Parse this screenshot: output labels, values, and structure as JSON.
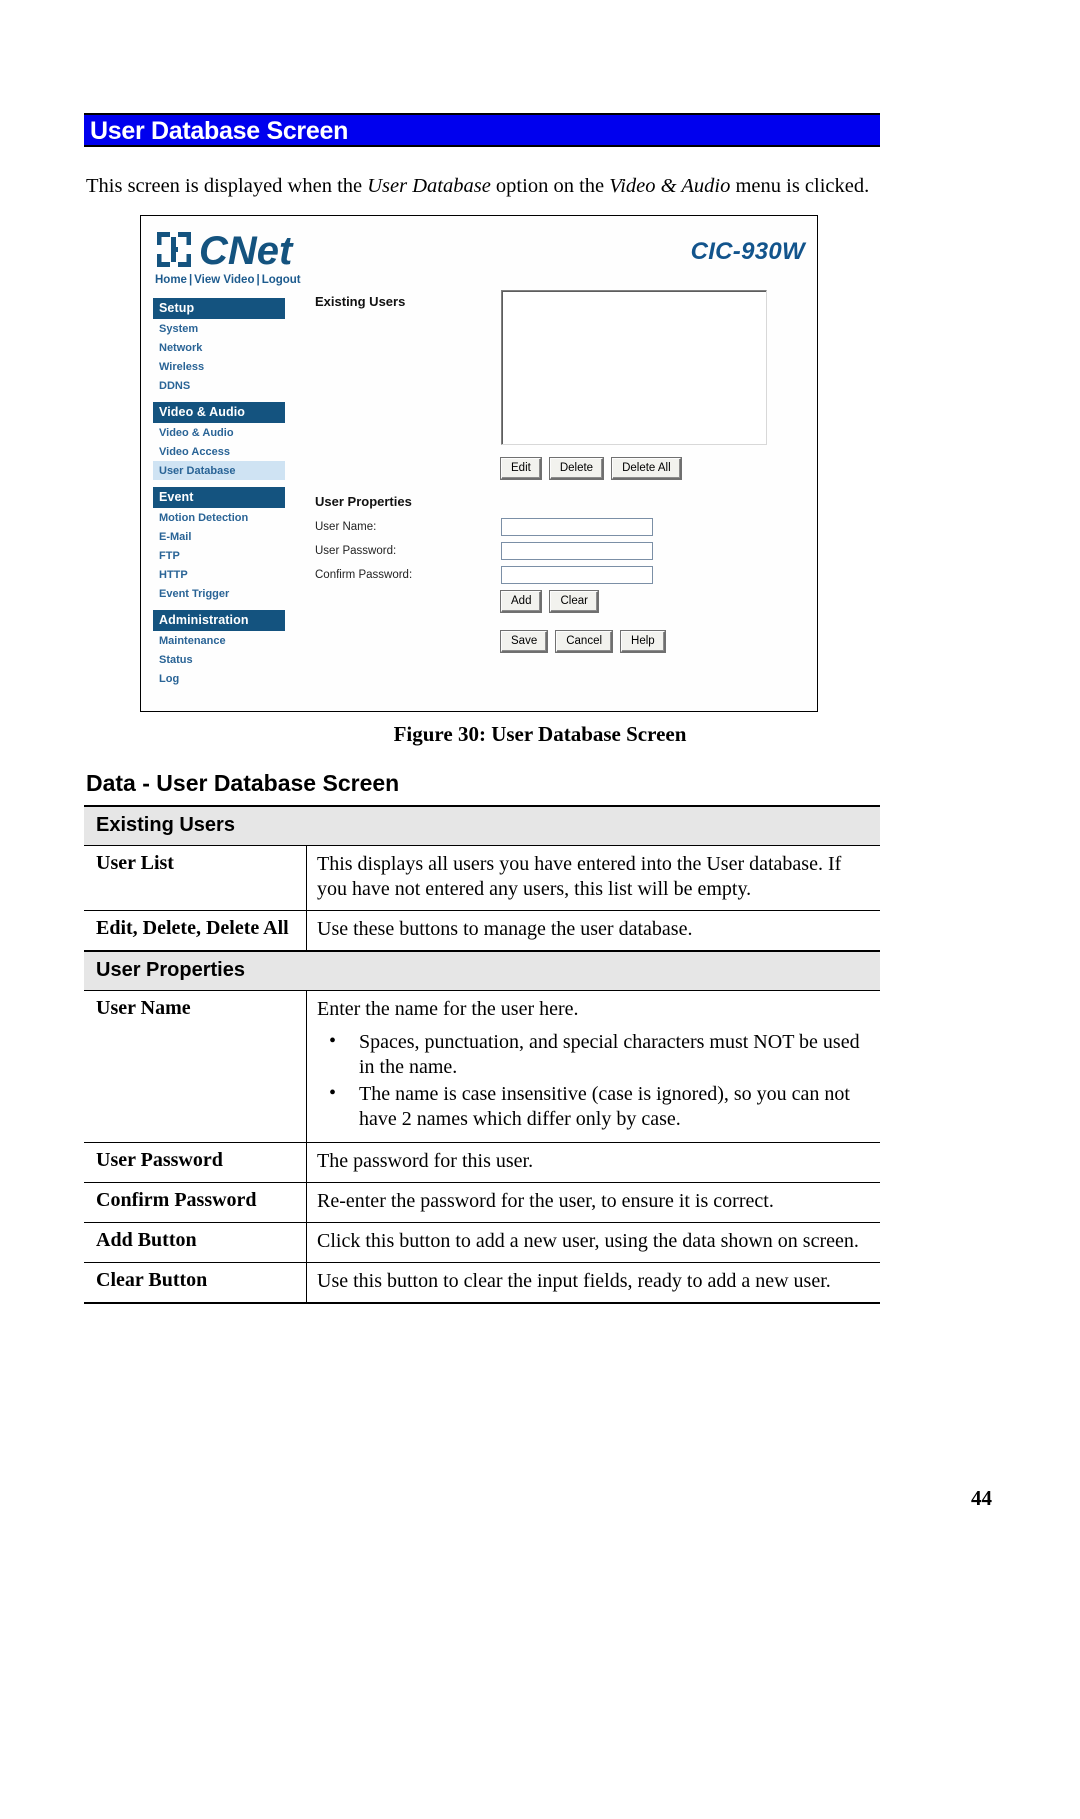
{
  "document": {
    "title": "User Database Screen",
    "intro_before": "This screen is displayed when the ",
    "intro_italic_1": "User Database",
    "intro_middle": " option on the ",
    "intro_italic_2": "Video & Audio",
    "intro_after": " menu is clicked.",
    "figure_caption": "Figure 30: User Database Screen",
    "data_heading": "Data - User Database Screen",
    "page_number": "44",
    "accent_color": "#0000ee"
  },
  "figure": {
    "brand": "CNet",
    "model": "CIC-930W",
    "top_links": [
      "Home",
      "View Video",
      "Logout"
    ],
    "link_separator": "|",
    "nav": [
      {
        "type": "header",
        "label": "Setup"
      },
      {
        "type": "item",
        "label": "System",
        "selected": false
      },
      {
        "type": "item",
        "label": "Network",
        "selected": false
      },
      {
        "type": "item",
        "label": "Wireless",
        "selected": false
      },
      {
        "type": "item",
        "label": "DDNS",
        "selected": false
      },
      {
        "type": "header",
        "label": "Video & Audio"
      },
      {
        "type": "item",
        "label": "Video & Audio",
        "selected": false
      },
      {
        "type": "item",
        "label": "Video Access",
        "selected": false
      },
      {
        "type": "item",
        "label": "User Database",
        "selected": true
      },
      {
        "type": "header",
        "label": "Event"
      },
      {
        "type": "item",
        "label": "Motion Detection",
        "selected": false
      },
      {
        "type": "item",
        "label": "E-Mail",
        "selected": false
      },
      {
        "type": "item",
        "label": "FTP",
        "selected": false
      },
      {
        "type": "item",
        "label": "HTTP",
        "selected": false
      },
      {
        "type": "item",
        "label": "Event Trigger",
        "selected": false
      },
      {
        "type": "header",
        "label": "Administration"
      },
      {
        "type": "item",
        "label": "Maintenance",
        "selected": false
      },
      {
        "type": "item",
        "label": "Status",
        "selected": false
      },
      {
        "type": "item",
        "label": "Log",
        "selected": false
      }
    ],
    "existing_users": {
      "title": "Existing Users",
      "list_items": [],
      "buttons": [
        "Edit",
        "Delete",
        "Delete All"
      ]
    },
    "user_properties": {
      "title": "User Properties",
      "fields": [
        {
          "label": "User Name:",
          "value": "",
          "placeholder": ""
        },
        {
          "label": "User Password:",
          "value": "",
          "placeholder": ""
        },
        {
          "label": "Confirm Password:",
          "value": "",
          "placeholder": ""
        }
      ],
      "form_buttons": [
        "Add",
        "Clear"
      ],
      "action_buttons": [
        "Save",
        "Cancel",
        "Help"
      ]
    },
    "colors": {
      "nav_header_bg": "#14537f",
      "nav_link": "#2a6496",
      "selected_bg": "#cfe3f3",
      "logo": "#12548c"
    }
  },
  "data_table": {
    "groups": [
      {
        "label": "Existing Users",
        "rows": [
          {
            "key": "User List",
            "value": "This displays all users you have entered into the User database. If you have not entered any users, this list will be empty.",
            "bullets": []
          },
          {
            "key": "Edit, Delete, Delete All",
            "value": "Use these buttons to manage the user database.",
            "bullets": []
          }
        ]
      },
      {
        "label": "User Properties",
        "rows": [
          {
            "key": "User Name",
            "value": "Enter the name for the user here.",
            "bullets": [
              "Spaces, punctuation, and special characters must NOT be used in the name.",
              "The name is case insensitive (case is ignored), so you can not have 2 names which differ only by case."
            ]
          },
          {
            "key": "User Password",
            "value": "The password for this user.",
            "bullets": []
          },
          {
            "key": "Confirm Password",
            "value": "Re-enter the password for the user, to ensure it is correct.",
            "bullets": []
          },
          {
            "key": "Add Button",
            "value": "Click this button to add a new user, using the data shown on screen.",
            "bullets": []
          },
          {
            "key": "Clear Button",
            "value": "Use this button to clear the input fields, ready to add a new user.",
            "bullets": []
          }
        ]
      }
    ]
  }
}
